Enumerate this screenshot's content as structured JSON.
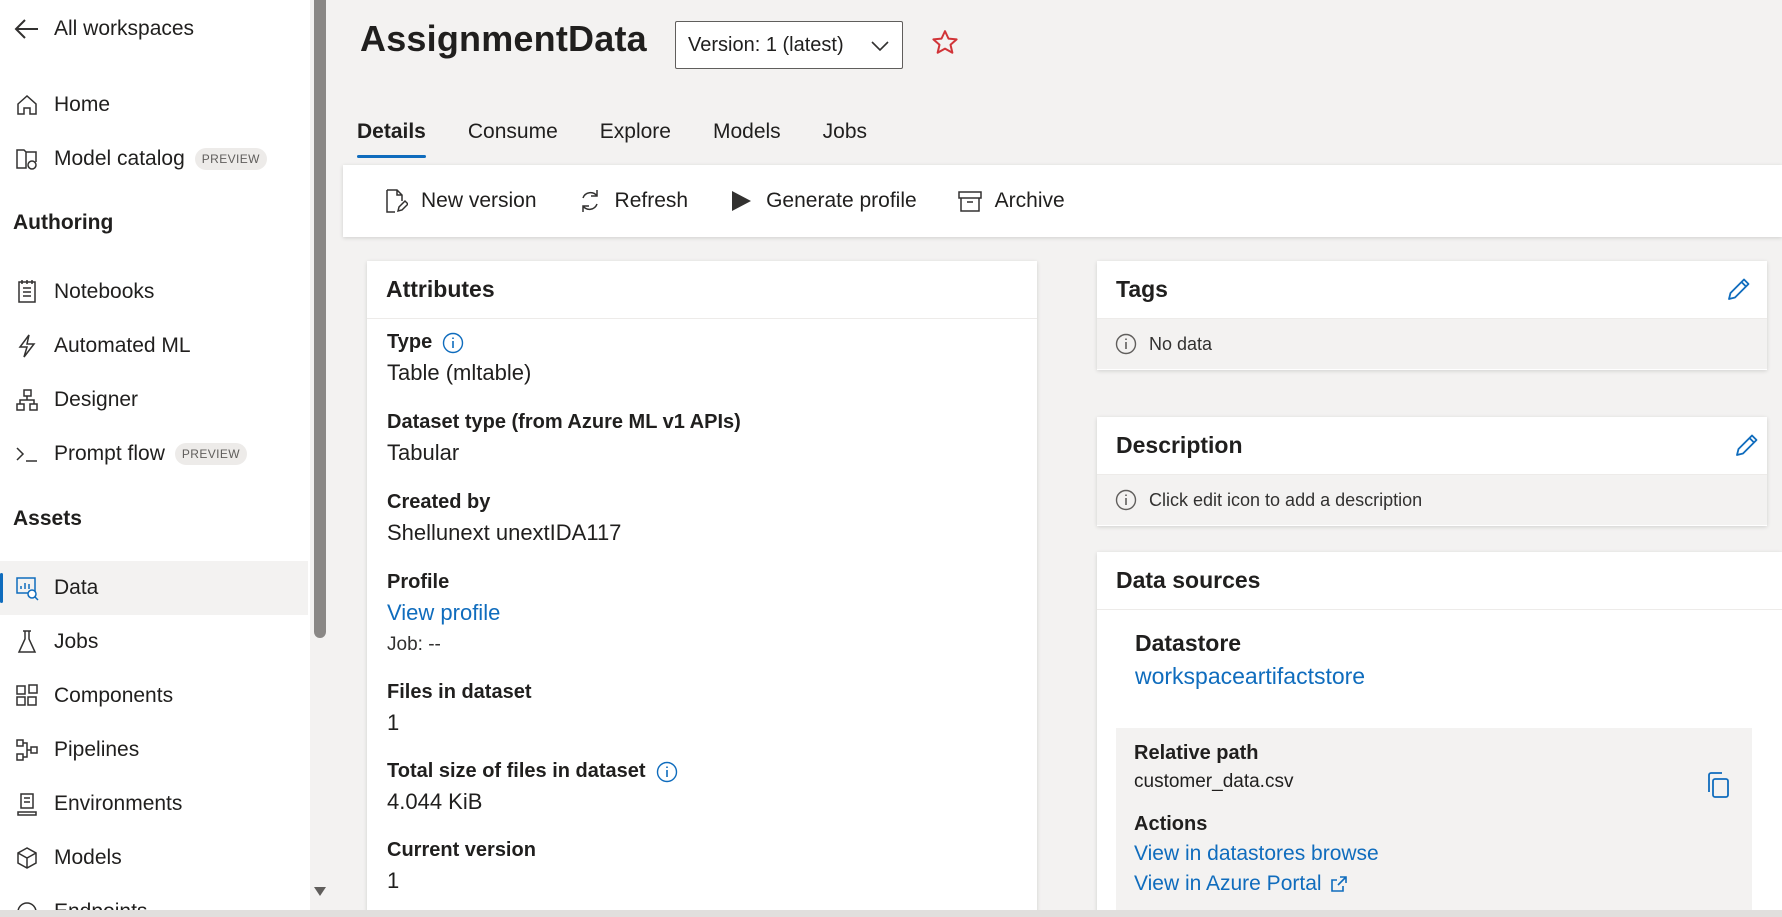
{
  "sidebar": {
    "back_label": "All workspaces",
    "items_top": [
      {
        "label": "Home",
        "icon": "home-icon"
      },
      {
        "label": "Model catalog",
        "icon": "model-catalog-icon",
        "badge": "PREVIEW"
      }
    ],
    "authoring_title": "Authoring",
    "authoring": [
      {
        "label": "Notebooks",
        "icon": "notebook-icon"
      },
      {
        "label": "Automated ML",
        "icon": "automl-icon"
      },
      {
        "label": "Designer",
        "icon": "designer-icon"
      },
      {
        "label": "Prompt flow",
        "icon": "prompt-flow-icon",
        "badge": "PREVIEW"
      }
    ],
    "assets_title": "Assets",
    "assets": [
      {
        "label": "Data",
        "icon": "data-icon",
        "active": true
      },
      {
        "label": "Jobs",
        "icon": "flask-icon"
      },
      {
        "label": "Components",
        "icon": "components-icon"
      },
      {
        "label": "Pipelines",
        "icon": "pipelines-icon"
      },
      {
        "label": "Environments",
        "icon": "environments-icon"
      },
      {
        "label": "Models",
        "icon": "cube-icon"
      },
      {
        "label": "Endpoints",
        "icon": "endpoints-icon"
      }
    ]
  },
  "header": {
    "title": "AssignmentData",
    "version": "Version: 1 (latest)"
  },
  "tabs": [
    "Details",
    "Consume",
    "Explore",
    "Models",
    "Jobs"
  ],
  "active_tab": "Details",
  "toolbar": {
    "new_version": "New version",
    "refresh": "Refresh",
    "generate_profile": "Generate profile",
    "archive": "Archive"
  },
  "attributes": {
    "title": "Attributes",
    "type_label": "Type",
    "type_value": "Table (mltable)",
    "dataset_type_label": "Dataset type (from Azure ML v1 APIs)",
    "dataset_type_value": "Tabular",
    "created_by_label": "Created by",
    "created_by_value": "Shellunext unextIDA117",
    "profile_label": "Profile",
    "profile_link": "View profile",
    "profile_job": "Job: --",
    "files_label": "Files in dataset",
    "files_value": "1",
    "size_label": "Total size of files in dataset",
    "size_value": "4.044 KiB",
    "current_version_label": "Current version",
    "current_version_value": "1"
  },
  "tags": {
    "title": "Tags",
    "empty": "No data"
  },
  "description": {
    "title": "Description",
    "empty": "Click edit icon to add a description"
  },
  "data_sources": {
    "title": "Data sources",
    "datastore_label": "Datastore",
    "datastore_value": "workspaceartifactstore",
    "relative_path_label": "Relative path",
    "relative_path_value": "customer_data.csv",
    "actions_label": "Actions",
    "action_browse": "View in datastores browse",
    "action_portal": "View in Azure Portal"
  },
  "colors": {
    "accent": "#0f6cbd",
    "star": "#d13438"
  }
}
